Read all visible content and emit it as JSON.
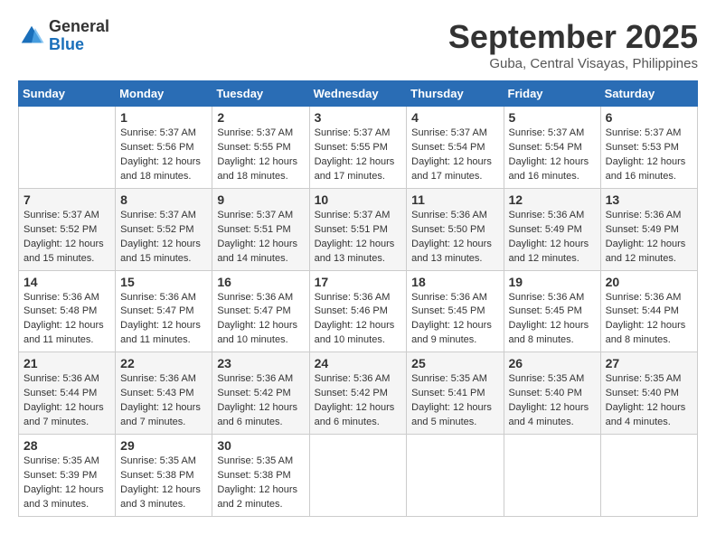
{
  "logo": {
    "general": "General",
    "blue": "Blue"
  },
  "title": "September 2025",
  "location": "Guba, Central Visayas, Philippines",
  "days_header": [
    "Sunday",
    "Monday",
    "Tuesday",
    "Wednesday",
    "Thursday",
    "Friday",
    "Saturday"
  ],
  "weeks": [
    [
      {
        "day": "",
        "text": ""
      },
      {
        "day": "1",
        "text": "Sunrise: 5:37 AM\nSunset: 5:56 PM\nDaylight: 12 hours\nand 18 minutes."
      },
      {
        "day": "2",
        "text": "Sunrise: 5:37 AM\nSunset: 5:55 PM\nDaylight: 12 hours\nand 18 minutes."
      },
      {
        "day": "3",
        "text": "Sunrise: 5:37 AM\nSunset: 5:55 PM\nDaylight: 12 hours\nand 17 minutes."
      },
      {
        "day": "4",
        "text": "Sunrise: 5:37 AM\nSunset: 5:54 PM\nDaylight: 12 hours\nand 17 minutes."
      },
      {
        "day": "5",
        "text": "Sunrise: 5:37 AM\nSunset: 5:54 PM\nDaylight: 12 hours\nand 16 minutes."
      },
      {
        "day": "6",
        "text": "Sunrise: 5:37 AM\nSunset: 5:53 PM\nDaylight: 12 hours\nand 16 minutes."
      }
    ],
    [
      {
        "day": "7",
        "text": "Sunrise: 5:37 AM\nSunset: 5:52 PM\nDaylight: 12 hours\nand 15 minutes."
      },
      {
        "day": "8",
        "text": "Sunrise: 5:37 AM\nSunset: 5:52 PM\nDaylight: 12 hours\nand 15 minutes."
      },
      {
        "day": "9",
        "text": "Sunrise: 5:37 AM\nSunset: 5:51 PM\nDaylight: 12 hours\nand 14 minutes."
      },
      {
        "day": "10",
        "text": "Sunrise: 5:37 AM\nSunset: 5:51 PM\nDaylight: 12 hours\nand 13 minutes."
      },
      {
        "day": "11",
        "text": "Sunrise: 5:36 AM\nSunset: 5:50 PM\nDaylight: 12 hours\nand 13 minutes."
      },
      {
        "day": "12",
        "text": "Sunrise: 5:36 AM\nSunset: 5:49 PM\nDaylight: 12 hours\nand 12 minutes."
      },
      {
        "day": "13",
        "text": "Sunrise: 5:36 AM\nSunset: 5:49 PM\nDaylight: 12 hours\nand 12 minutes."
      }
    ],
    [
      {
        "day": "14",
        "text": "Sunrise: 5:36 AM\nSunset: 5:48 PM\nDaylight: 12 hours\nand 11 minutes."
      },
      {
        "day": "15",
        "text": "Sunrise: 5:36 AM\nSunset: 5:47 PM\nDaylight: 12 hours\nand 11 minutes."
      },
      {
        "day": "16",
        "text": "Sunrise: 5:36 AM\nSunset: 5:47 PM\nDaylight: 12 hours\nand 10 minutes."
      },
      {
        "day": "17",
        "text": "Sunrise: 5:36 AM\nSunset: 5:46 PM\nDaylight: 12 hours\nand 10 minutes."
      },
      {
        "day": "18",
        "text": "Sunrise: 5:36 AM\nSunset: 5:45 PM\nDaylight: 12 hours\nand 9 minutes."
      },
      {
        "day": "19",
        "text": "Sunrise: 5:36 AM\nSunset: 5:45 PM\nDaylight: 12 hours\nand 8 minutes."
      },
      {
        "day": "20",
        "text": "Sunrise: 5:36 AM\nSunset: 5:44 PM\nDaylight: 12 hours\nand 8 minutes."
      }
    ],
    [
      {
        "day": "21",
        "text": "Sunrise: 5:36 AM\nSunset: 5:44 PM\nDaylight: 12 hours\nand 7 minutes."
      },
      {
        "day": "22",
        "text": "Sunrise: 5:36 AM\nSunset: 5:43 PM\nDaylight: 12 hours\nand 7 minutes."
      },
      {
        "day": "23",
        "text": "Sunrise: 5:36 AM\nSunset: 5:42 PM\nDaylight: 12 hours\nand 6 minutes."
      },
      {
        "day": "24",
        "text": "Sunrise: 5:36 AM\nSunset: 5:42 PM\nDaylight: 12 hours\nand 6 minutes."
      },
      {
        "day": "25",
        "text": "Sunrise: 5:35 AM\nSunset: 5:41 PM\nDaylight: 12 hours\nand 5 minutes."
      },
      {
        "day": "26",
        "text": "Sunrise: 5:35 AM\nSunset: 5:40 PM\nDaylight: 12 hours\nand 4 minutes."
      },
      {
        "day": "27",
        "text": "Sunrise: 5:35 AM\nSunset: 5:40 PM\nDaylight: 12 hours\nand 4 minutes."
      }
    ],
    [
      {
        "day": "28",
        "text": "Sunrise: 5:35 AM\nSunset: 5:39 PM\nDaylight: 12 hours\nand 3 minutes."
      },
      {
        "day": "29",
        "text": "Sunrise: 5:35 AM\nSunset: 5:38 PM\nDaylight: 12 hours\nand 3 minutes."
      },
      {
        "day": "30",
        "text": "Sunrise: 5:35 AM\nSunset: 5:38 PM\nDaylight: 12 hours\nand 2 minutes."
      },
      {
        "day": "",
        "text": ""
      },
      {
        "day": "",
        "text": ""
      },
      {
        "day": "",
        "text": ""
      },
      {
        "day": "",
        "text": ""
      }
    ]
  ]
}
